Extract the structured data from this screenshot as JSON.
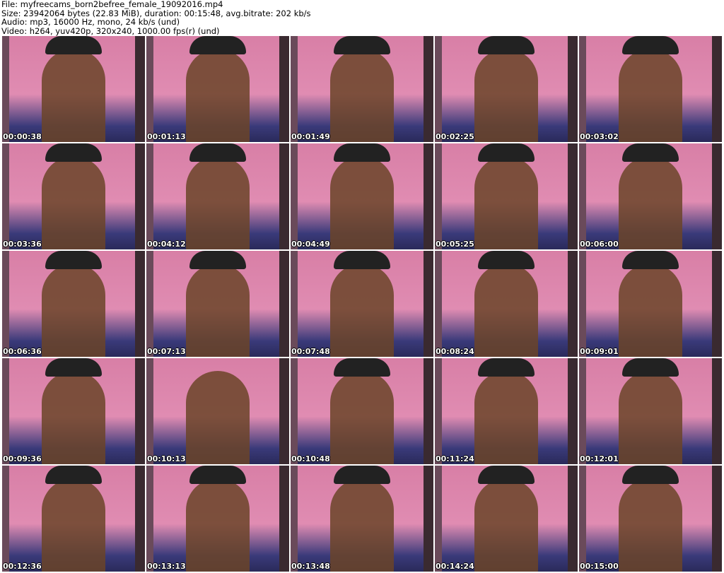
{
  "header": {
    "file": "File: myfreecams_born2befree_female_19092016.mp4",
    "size": "Size: 23942064 bytes (22.83 MiB), duration: 00:15:48, avg.bitrate: 202 kb/s",
    "audio": "Audio: mp3, 16000 Hz, mono, 24 kb/s (und)",
    "video": "Video: h264, yuv420p, 320x240, 1000.00 fps(r) (und)"
  },
  "thumbnails": [
    "00:00:38",
    "00:01:13",
    "00:01:49",
    "00:02:25",
    "00:03:02",
    "00:03:36",
    "00:04:12",
    "00:04:49",
    "00:05:25",
    "00:06:00",
    "00:06:36",
    "00:07:13",
    "00:07:48",
    "00:08:24",
    "00:09:01",
    "00:09:36",
    "00:10:13",
    "00:10:48",
    "00:11:24",
    "00:12:01",
    "00:12:36",
    "00:13:13",
    "00:13:48",
    "00:14:24",
    "00:15:00"
  ]
}
